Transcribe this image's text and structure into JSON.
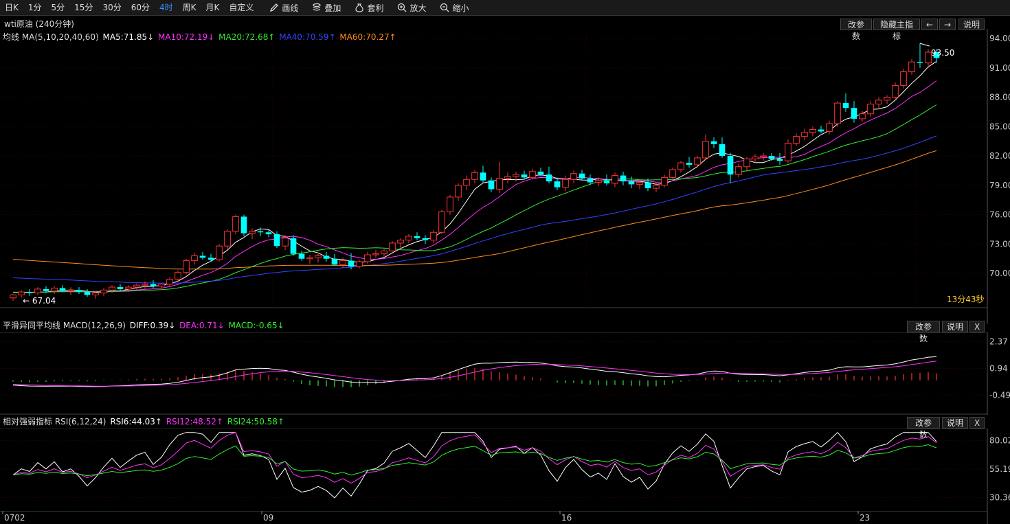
{
  "toolbar": {
    "periods": [
      "日K",
      "1分",
      "5分",
      "15分",
      "30分",
      "60分",
      "4时",
      "周K",
      "月K",
      "自定义"
    ],
    "active_period": "4时",
    "tools": [
      {
        "label": "画线",
        "icon": "pencil-icon"
      },
      {
        "label": "叠加",
        "icon": "stack-icon"
      },
      {
        "label": "套利",
        "icon": "moneybag-icon"
      },
      {
        "label": "放大",
        "icon": "zoom-in-icon"
      },
      {
        "label": "缩小",
        "icon": "zoom-out-icon"
      }
    ]
  },
  "main_chart": {
    "title": "wti原油 (240分钟)",
    "buttons": {
      "params": "改参数",
      "hide": "隐藏主指标",
      "left": "←",
      "right": "→",
      "help": "说明"
    },
    "indicator_name": "均线 MA(5,10,20,40,60)",
    "ma_values": [
      {
        "label": "MA5:71.85↓",
        "color": "#ffffff"
      },
      {
        "label": "MA10:72.19↓",
        "color": "#ff33ff"
      },
      {
        "label": "MA20:72.68↑",
        "color": "#33ee33"
      },
      {
        "label": "MA40:70.59↑",
        "color": "#3344ff"
      },
      {
        "label": "MA60:70.27↑",
        "color": "#ff8c1a"
      }
    ],
    "y_ticks": [
      "94.00",
      "91.00",
      "88.00",
      "85.00",
      "82.00",
      "79.00",
      "76.00",
      "73.00",
      "70.00"
    ],
    "high_label": "93.50",
    "low_label": "67.04",
    "countdown": "13分43秒"
  },
  "macd_panel": {
    "title": "平滑异同平均线 MACD(12,26,9)",
    "values": [
      {
        "label": "DIFF:0.39↓",
        "color": "#ffffff"
      },
      {
        "label": "DEA:0.71↓",
        "color": "#ff33ff"
      },
      {
        "label": "MACD:-0.65↓",
        "color": "#33ee33"
      }
    ],
    "buttons": {
      "params": "改参数",
      "help": "说明",
      "close": "X"
    },
    "y_ticks": [
      "2.37",
      "0.94",
      "-0.49"
    ]
  },
  "rsi_panel": {
    "title": "相对强弱指标 RSI(6,12,24)",
    "values": [
      {
        "label": "RSI6:44.03↑",
        "color": "#ffffff"
      },
      {
        "label": "RSI12:48.52↑",
        "color": "#ff33ff"
      },
      {
        "label": "RSI24:50.58↑",
        "color": "#33ee33"
      }
    ],
    "buttons": {
      "params": "改参数",
      "help": "说明",
      "close": "X"
    },
    "y_ticks": [
      "80.02",
      "55.19",
      "30.36"
    ]
  },
  "x_axis": {
    "labels": [
      "0702",
      "09",
      "16",
      "23"
    ]
  },
  "colors": {
    "up": "#ff3333",
    "down": "#00ffff",
    "grid": "#2a0000",
    "ma5": "#ffffff",
    "ma10": "#ff33ff",
    "ma20": "#33ee33",
    "ma40": "#3344ff",
    "ma60": "#ff8c1a"
  },
  "chart_data": {
    "type": "candlestick",
    "candles": [
      [
        67.5,
        67.9,
        67.2,
        67.8
      ],
      [
        67.8,
        68.3,
        67.5,
        68.1
      ],
      [
        68.1,
        68.4,
        67.7,
        68.0
      ],
      [
        68.0,
        68.6,
        67.8,
        68.4
      ],
      [
        68.4,
        68.7,
        68.0,
        68.2
      ],
      [
        68.2,
        68.7,
        67.9,
        68.5
      ],
      [
        68.5,
        68.8,
        68.1,
        68.2
      ],
      [
        68.2,
        68.6,
        67.8,
        68.3
      ],
      [
        68.3,
        68.6,
        67.9,
        68.1
      ],
      [
        68.1,
        68.4,
        67.6,
        67.8
      ],
      [
        67.8,
        68.2,
        67.4,
        68.0
      ],
      [
        68.0,
        68.5,
        67.7,
        68.3
      ],
      [
        68.3,
        68.8,
        68.0,
        68.6
      ],
      [
        68.6,
        68.9,
        68.2,
        68.4
      ],
      [
        68.4,
        68.8,
        68.1,
        68.6
      ],
      [
        68.6,
        69.0,
        68.3,
        68.8
      ],
      [
        68.8,
        69.2,
        68.4,
        68.9
      ],
      [
        68.9,
        69.3,
        68.5,
        68.7
      ],
      [
        68.7,
        69.0,
        68.3,
        68.9
      ],
      [
        68.9,
        69.6,
        68.7,
        69.4
      ],
      [
        69.4,
        70.3,
        69.1,
        70.1
      ],
      [
        70.1,
        71.5,
        69.9,
        71.3
      ],
      [
        71.3,
        72.1,
        70.9,
        71.8
      ],
      [
        71.8,
        72.2,
        71.4,
        71.6
      ],
      [
        71.6,
        72.0,
        71.2,
        71.4
      ],
      [
        71.4,
        73.0,
        71.2,
        72.8
      ],
      [
        72.8,
        74.5,
        72.5,
        74.3
      ],
      [
        74.3,
        76.0,
        74.0,
        75.8
      ],
      [
        75.8,
        76.0,
        73.8,
        74.1
      ],
      [
        74.1,
        74.6,
        73.5,
        74.3
      ],
      [
        74.3,
        74.7,
        73.8,
        74.2
      ],
      [
        74.2,
        74.4,
        73.7,
        74.0
      ],
      [
        74.0,
        74.3,
        72.6,
        72.8
      ],
      [
        72.8,
        73.9,
        72.4,
        73.6
      ],
      [
        73.6,
        73.9,
        71.8,
        72.0
      ],
      [
        72.0,
        72.3,
        71.3,
        71.5
      ],
      [
        71.5,
        71.9,
        71.0,
        71.6
      ],
      [
        71.6,
        72.0,
        71.1,
        71.8
      ],
      [
        71.8,
        72.2,
        71.2,
        71.5
      ],
      [
        71.5,
        72.0,
        70.8,
        70.9
      ],
      [
        70.9,
        71.6,
        70.6,
        71.3
      ],
      [
        71.3,
        72.1,
        70.4,
        70.7
      ],
      [
        70.7,
        71.4,
        70.5,
        71.2
      ],
      [
        71.2,
        72.2,
        71.0,
        71.9
      ],
      [
        71.9,
        72.4,
        71.6,
        72.0
      ],
      [
        72.0,
        72.5,
        71.7,
        72.3
      ],
      [
        72.3,
        73.3,
        72.0,
        73.1
      ],
      [
        73.1,
        73.6,
        72.6,
        73.4
      ],
      [
        73.4,
        74.0,
        73.1,
        73.8
      ],
      [
        73.8,
        74.2,
        73.4,
        73.6
      ],
      [
        73.6,
        73.9,
        73.0,
        73.4
      ],
      [
        73.4,
        74.4,
        73.1,
        74.2
      ],
      [
        74.2,
        76.5,
        74.0,
        76.3
      ],
      [
        76.3,
        78.0,
        76.0,
        77.8
      ],
      [
        77.8,
        79.2,
        77.4,
        79.0
      ],
      [
        79.0,
        80.0,
        78.5,
        79.6
      ],
      [
        79.6,
        80.6,
        79.2,
        80.3
      ],
      [
        80.3,
        81.0,
        79.3,
        79.5
      ],
      [
        79.5,
        79.8,
        78.3,
        78.6
      ],
      [
        78.6,
        81.4,
        78.2,
        79.7
      ],
      [
        79.7,
        80.3,
        79.2,
        79.9
      ],
      [
        79.9,
        80.4,
        79.4,
        80.1
      ],
      [
        80.1,
        80.5,
        79.6,
        79.8
      ],
      [
        79.8,
        80.7,
        79.6,
        80.4
      ],
      [
        80.4,
        80.8,
        79.9,
        80.1
      ],
      [
        80.1,
        80.9,
        79.2,
        79.4
      ],
      [
        79.4,
        79.8,
        78.5,
        78.8
      ],
      [
        78.8,
        80.0,
        78.4,
        79.6
      ],
      [
        79.6,
        80.5,
        79.2,
        80.2
      ],
      [
        80.2,
        80.6,
        79.5,
        79.7
      ],
      [
        79.7,
        80.1,
        79.0,
        79.3
      ],
      [
        79.3,
        79.8,
        78.9,
        79.5
      ],
      [
        79.5,
        80.1,
        79.0,
        79.2
      ],
      [
        79.2,
        80.3,
        78.8,
        80.0
      ],
      [
        80.0,
        80.4,
        79.0,
        79.4
      ],
      [
        79.4,
        79.9,
        78.7,
        79.1
      ],
      [
        79.1,
        79.6,
        78.6,
        79.3
      ],
      [
        79.3,
        79.7,
        78.4,
        78.7
      ],
      [
        78.7,
        79.3,
        78.3,
        79.0
      ],
      [
        79.0,
        80.1,
        78.8,
        79.8
      ],
      [
        79.8,
        80.8,
        79.6,
        80.6
      ],
      [
        80.6,
        81.5,
        80.3,
        81.3
      ],
      [
        81.3,
        81.9,
        80.8,
        81.1
      ],
      [
        81.1,
        82.0,
        80.8,
        81.8
      ],
      [
        81.8,
        84.2,
        81.6,
        83.5
      ],
      [
        83.5,
        83.9,
        82.8,
        83.2
      ],
      [
        83.2,
        83.9,
        81.8,
        82.0
      ],
      [
        82.0,
        82.3,
        79.2,
        80.1
      ],
      [
        80.1,
        81.2,
        79.8,
        80.9
      ],
      [
        80.9,
        81.9,
        80.5,
        81.7
      ],
      [
        81.7,
        82.2,
        81.3,
        81.9
      ],
      [
        81.9,
        82.3,
        81.5,
        82.0
      ],
      [
        82.0,
        82.3,
        81.5,
        81.7
      ],
      [
        81.7,
        82.3,
        81.1,
        81.5
      ],
      [
        81.5,
        83.7,
        81.3,
        83.3
      ],
      [
        83.3,
        84.3,
        83.0,
        84.0
      ],
      [
        84.0,
        84.8,
        83.6,
        84.4
      ],
      [
        84.4,
        85.0,
        84.0,
        84.7
      ],
      [
        84.7,
        85.1,
        84.3,
        84.5
      ],
      [
        84.5,
        85.6,
        84.2,
        85.3
      ],
      [
        85.3,
        87.6,
        85.0,
        87.4
      ],
      [
        87.4,
        88.4,
        86.5,
        86.9
      ],
      [
        86.9,
        87.6,
        85.4,
        85.8
      ],
      [
        85.8,
        86.6,
        85.5,
        86.3
      ],
      [
        86.3,
        87.6,
        86.0,
        87.3
      ],
      [
        87.3,
        88.0,
        86.9,
        87.7
      ],
      [
        87.7,
        88.2,
        87.3,
        88.0
      ],
      [
        88.0,
        89.5,
        87.7,
        89.2
      ],
      [
        89.2,
        90.9,
        88.9,
        90.6
      ],
      [
        90.6,
        91.9,
        90.3,
        91.6
      ],
      [
        91.6,
        93.5,
        91.0,
        91.5
      ],
      [
        91.5,
        92.9,
        91.0,
        92.6
      ],
      [
        92.6,
        92.9,
        91.5,
        92.0
      ]
    ],
    "y_range": [
      66.5,
      94.0
    ],
    "macd_range": [
      -1.4,
      2.8
    ],
    "rsi_range": [
      20,
      88
    ]
  }
}
